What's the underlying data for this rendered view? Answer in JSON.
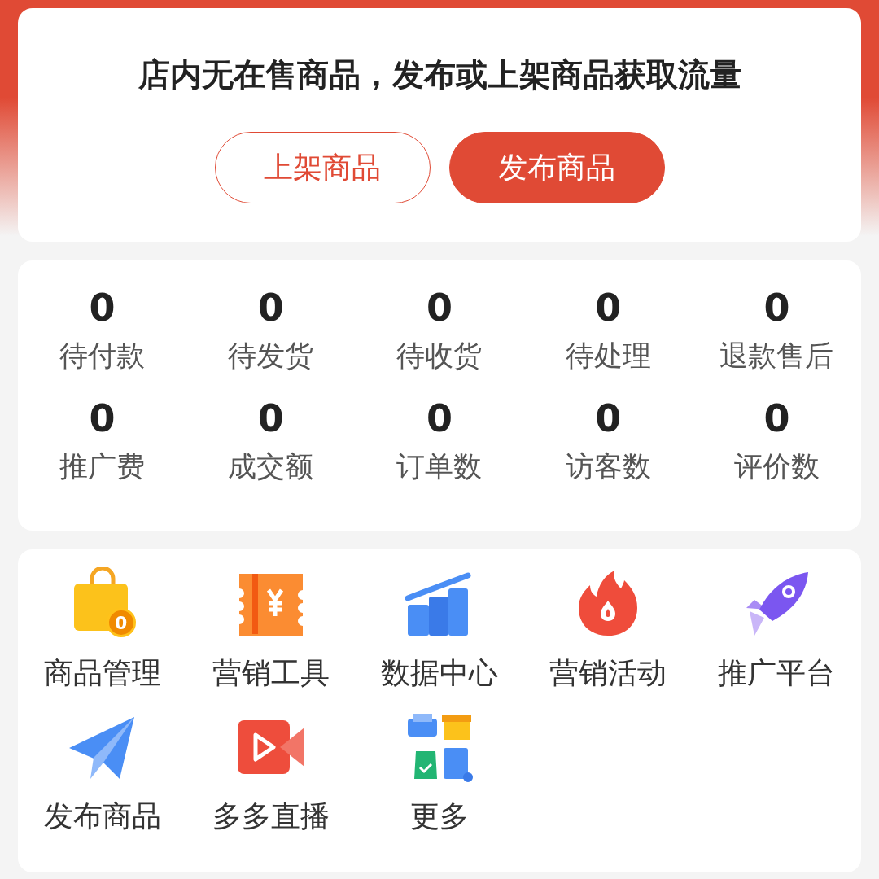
{
  "banner": {
    "message": "店内无在售商品，发布或上架商品获取流量",
    "buttons": [
      {
        "label": "上架商品",
        "kind": "outline"
      },
      {
        "label": "发布商品",
        "kind": "filled"
      }
    ]
  },
  "stats": [
    {
      "value": "0",
      "label": "待付款"
    },
    {
      "value": "0",
      "label": "待发货"
    },
    {
      "value": "0",
      "label": "待收货"
    },
    {
      "value": "0",
      "label": "待处理"
    },
    {
      "value": "0",
      "label": "退款售后"
    },
    {
      "value": "0",
      "label": "推广费"
    },
    {
      "value": "0",
      "label": "成交额"
    },
    {
      "value": "0",
      "label": "订单数"
    },
    {
      "value": "0",
      "label": "访客数"
    },
    {
      "value": "0",
      "label": "评价数"
    }
  ],
  "tools": [
    {
      "label": "商品管理",
      "kind": "bag",
      "badge": "0"
    },
    {
      "label": "营销工具",
      "kind": "coupon"
    },
    {
      "label": "数据中心",
      "kind": "chart"
    },
    {
      "label": "营销活动",
      "kind": "fire"
    },
    {
      "label": "推广平台",
      "kind": "rocket"
    },
    {
      "label": "发布商品",
      "kind": "plane"
    },
    {
      "label": "多多直播",
      "kind": "video"
    },
    {
      "label": "更多",
      "kind": "more"
    }
  ]
}
